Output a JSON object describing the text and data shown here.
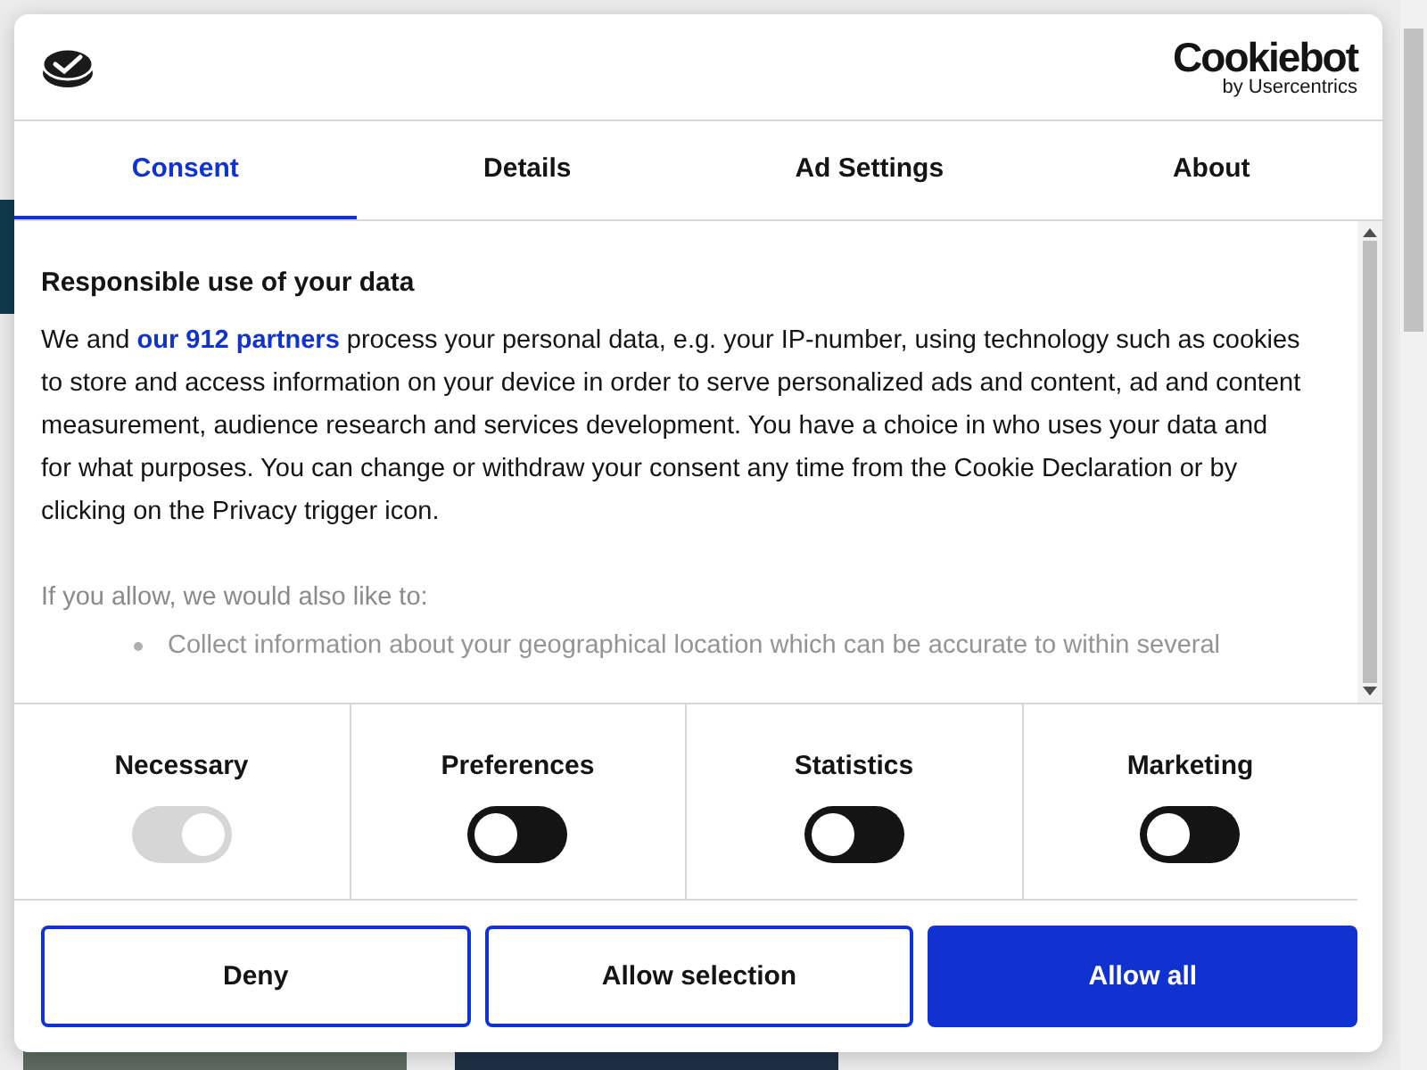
{
  "logo": {
    "name": "Cookiebot",
    "tagline": "by Usercentrics"
  },
  "tabs": [
    {
      "label": "Consent",
      "selected": true
    },
    {
      "label": "Details",
      "selected": false
    },
    {
      "label": "Ad Settings",
      "selected": false
    },
    {
      "label": "About",
      "selected": false
    }
  ],
  "body": {
    "heading": "Responsible use of your data",
    "text_before": "We and ",
    "link": "our 912 partners",
    "text_after": " process your personal data, e.g. your IP-number, using technology such as cookies to store and access information on your device in order to serve personalized ads and content, ad and content measurement, audience research and services development. You have a choice in who uses your data and for what purposes. You can change or withdraw your consent any time from the Cookie Declaration or by clicking on the Privacy trigger icon.",
    "also": "If you allow, we would also like to:",
    "bullets": [
      "Collect information about your geographical location which can be accurate to within several"
    ]
  },
  "toggles": [
    {
      "label": "Necessary",
      "checked": true,
      "disabled": true
    },
    {
      "label": "Preferences",
      "checked": false,
      "disabled": false
    },
    {
      "label": "Statistics",
      "checked": false,
      "disabled": false
    },
    {
      "label": "Marketing",
      "checked": false,
      "disabled": false
    }
  ],
  "buttons": [
    {
      "label": "Deny",
      "kind": "outline"
    },
    {
      "label": "Allow selection",
      "kind": "outline"
    },
    {
      "label": "Allow all",
      "kind": "primary"
    }
  ]
}
